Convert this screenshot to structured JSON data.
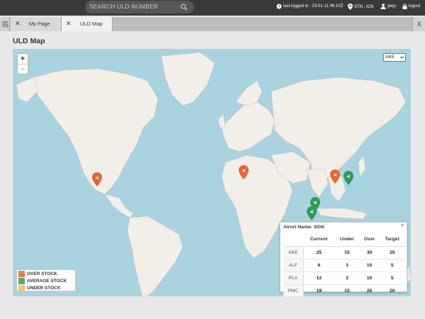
{
  "header": {
    "search_placeholder": "SEARCH ULD NUMBER",
    "last_logged": "last logged in : 23-01-11 06:10Z",
    "station": "STN : ICN",
    "user": "ywju",
    "logout": "logout"
  },
  "tabs": [
    {
      "label": "My Page",
      "active": false
    },
    {
      "label": "ULD Map",
      "active": true
    }
  ],
  "close_all": "X",
  "page_title": "ULD Map",
  "map": {
    "zoom_in": "+",
    "zoom_out": "−",
    "selected_uld_type": "AKE",
    "markers": [
      {
        "location": "Los Angeles",
        "status": "over stock"
      },
      {
        "location": "Istanbul",
        "status": "over stock"
      },
      {
        "location": "Seoul",
        "status": "over stock"
      },
      {
        "location": "Tokyo",
        "status": "average stock"
      },
      {
        "location": "Saigon",
        "status": "average stock"
      },
      {
        "location": "Kuala Lumpur",
        "status": "average stock"
      }
    ]
  },
  "legend": {
    "items": [
      {
        "label": "OVER STOCK",
        "color": "#ee7b45"
      },
      {
        "label": "AVERAGE STOCK",
        "color": "#5fa86e"
      },
      {
        "label": "UNDER STOCK",
        "color": "#f4c46a"
      }
    ]
  },
  "popup": {
    "title": "Airort Name: SGN",
    "close": "×",
    "columns": [
      "",
      "Current",
      "Under",
      "Over",
      "Target"
    ],
    "rows": [
      [
        "AKE",
        "25",
        "15",
        "30",
        "25"
      ],
      [
        "ALF",
        "6",
        "3",
        "10",
        "5"
      ],
      [
        "PLA",
        "12",
        "3",
        "10",
        "5"
      ],
      [
        "PMC",
        "19",
        "15",
        "25",
        "20"
      ]
    ]
  },
  "colors": {
    "over": "#e8662b",
    "average": "#2f9b57",
    "sea": "#a9d3df",
    "land": "#f2efe9"
  }
}
